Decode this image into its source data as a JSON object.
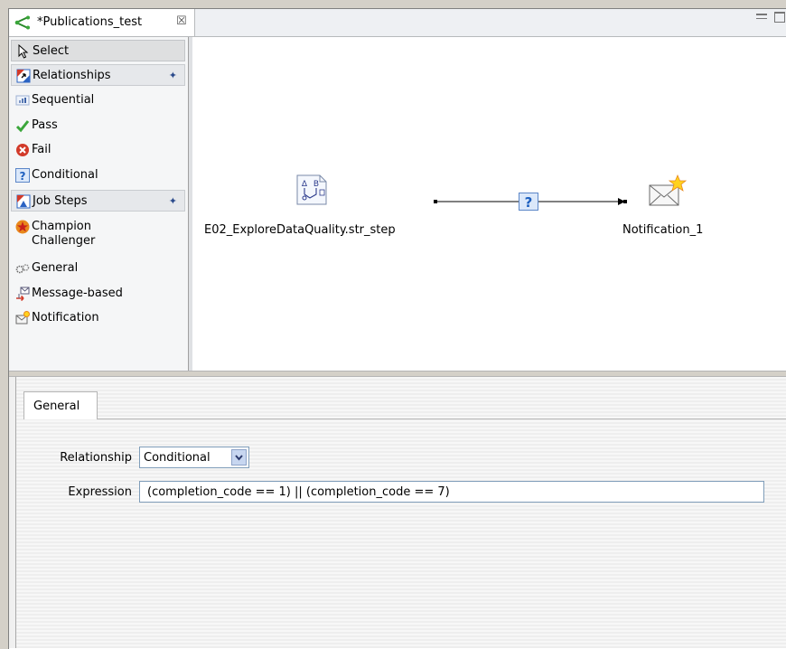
{
  "editor": {
    "tab_title": "*Publications_test",
    "tab_icon": "process-flow-icon",
    "close_glyph": "☒"
  },
  "palette": {
    "select": {
      "label": "Select",
      "icon": "arrow-cursor-icon"
    },
    "relationships": {
      "label": "Relationships",
      "icon": "relationships-drawer-icon",
      "pinned": true,
      "items": [
        {
          "label": "Sequential",
          "icon": "sequential-icon"
        },
        {
          "label": "Pass",
          "icon": "checkmark-icon"
        },
        {
          "label": "Fail",
          "icon": "fail-x-icon"
        },
        {
          "label": "Conditional",
          "icon": "question-mark-icon"
        }
      ]
    },
    "job_steps": {
      "label": "Job Steps",
      "icon": "job-steps-drawer-icon",
      "pinned": true,
      "items": [
        {
          "label_line1": "Champion",
          "label_line2": "Challenger",
          "icon": "star-icon"
        },
        {
          "label": "General",
          "icon": "gears-icon"
        },
        {
          "label": "Message-based",
          "icon": "message-icon"
        },
        {
          "label": "Notification",
          "icon": "envelope-icon"
        }
      ]
    }
  },
  "canvas": {
    "source_node": {
      "label": "E02_ExploreDataQuality.str_step",
      "icon": "workflow-step-icon"
    },
    "target_node": {
      "label": "Notification_1",
      "icon": "notification-envelope-icon"
    },
    "connection": {
      "type": "Conditional",
      "marker": "?"
    }
  },
  "properties": {
    "tab": "General",
    "relationship_label": "Relationship",
    "relationship_value": "Conditional",
    "expression_label": "Expression",
    "expression_value": "(completion_code == 1) || (completion_code == 7)"
  },
  "colors": {
    "selection_blue": "#2b63c3",
    "conditional_box": "#dbe8fa",
    "conditional_text": "#1d5fbf",
    "fail_red": "#d23a2a",
    "pass_green": "#3aa63a",
    "star_orange": "#e8881c"
  }
}
